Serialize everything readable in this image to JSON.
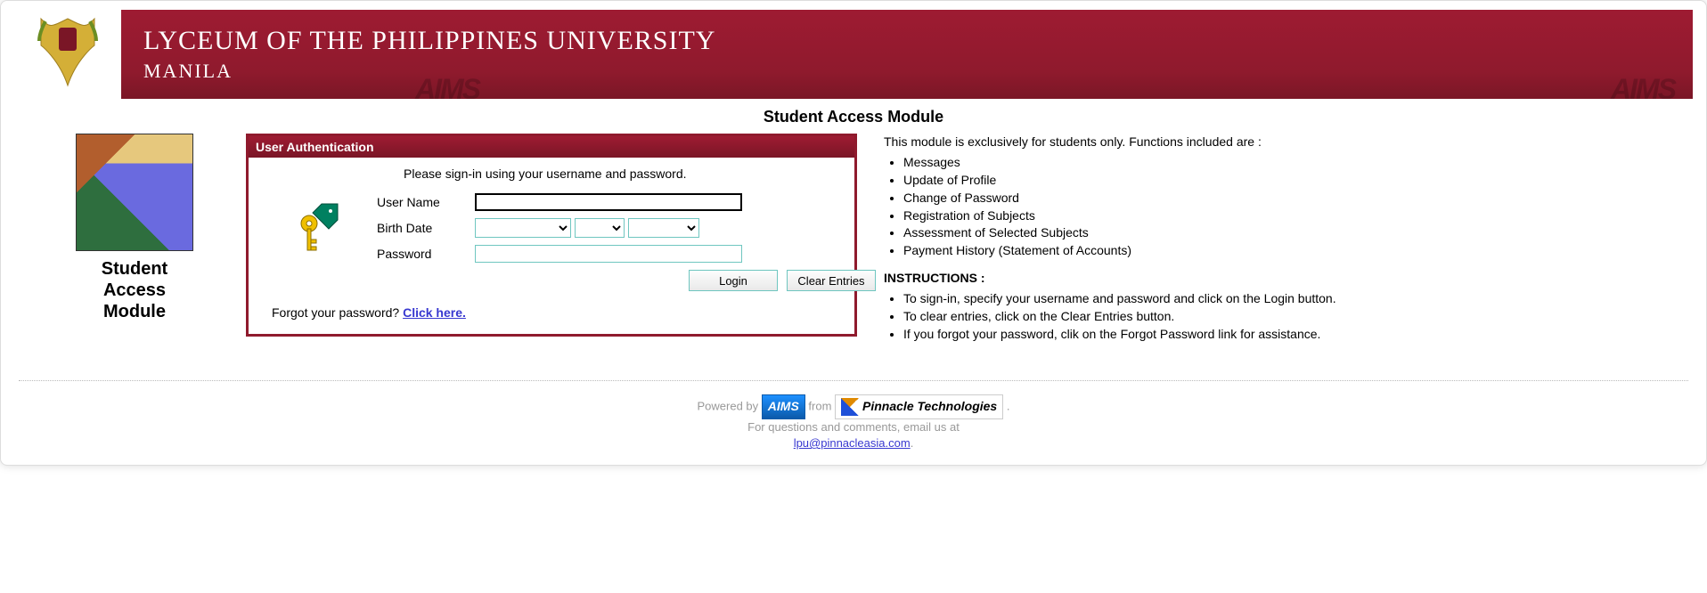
{
  "banner": {
    "title": "LYCEUM OF THE PHILIPPINES UNIVERSITY",
    "subtitle": "MANILA",
    "watermark": "AIMS"
  },
  "page": {
    "heading": "Student Access Module"
  },
  "sidebar": {
    "caption_line1": "Student",
    "caption_line2": "Access",
    "caption_line3": "Module"
  },
  "auth": {
    "header": "User Authentication",
    "instruction": "Please sign-in using your username and password.",
    "labels": {
      "username": "User Name",
      "birthdate": "Birth Date",
      "password": "Password"
    },
    "values": {
      "username": "",
      "password": "",
      "month": "",
      "day": "",
      "year": ""
    },
    "buttons": {
      "login": "Login",
      "clear": "Clear Entries"
    },
    "forgot_prefix": "Forgot your password? ",
    "forgot_link": "Click here."
  },
  "info": {
    "intro": "This module is exclusively for students only. Functions included are :",
    "functions": [
      "Messages",
      "Update of Profile",
      "Change of Password",
      "Registration of Subjects",
      "Assessment of Selected Subjects",
      "Payment History (Statement of Accounts)"
    ],
    "instructions_title": "INSTRUCTIONS :",
    "instructions": [
      "To sign-in, specify your username and password and click on the Login button.",
      "To clear entries, click on the Clear Entries button.",
      "If you forgot your password, clik on the Forgot Password link for assistance."
    ]
  },
  "footer": {
    "powered_prefix": "Powered by ",
    "powered_mid": " from ",
    "aims_name": "AIMS",
    "pinnacle_name": "Pinnacle Technologies",
    "contact_line": "For questions and comments, email us at",
    "email": "lpu@pinnacleasia.com",
    "dot": "."
  }
}
